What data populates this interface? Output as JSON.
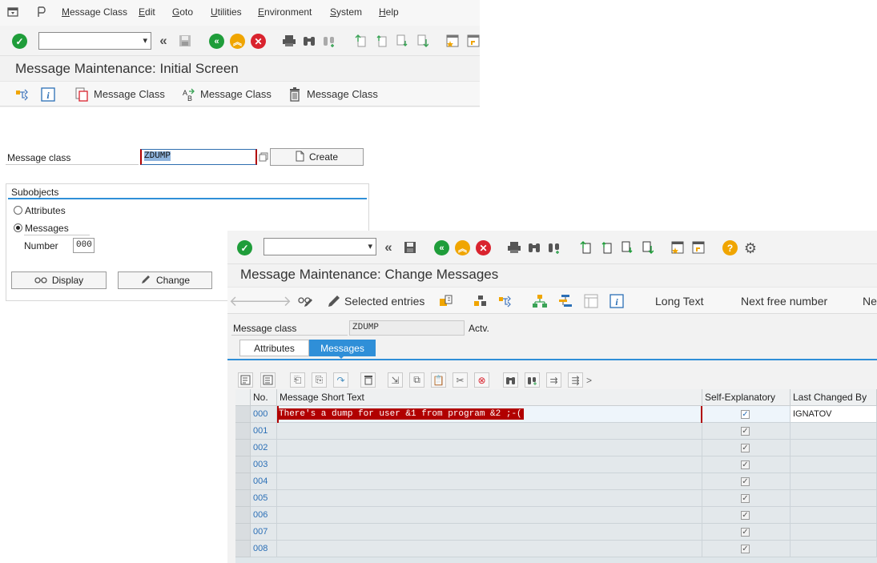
{
  "menu": {
    "items": [
      "Message Class",
      "Edit",
      "Goto",
      "Utilities",
      "Environment",
      "System",
      "Help"
    ],
    "underlines": [
      "M",
      "E",
      "G",
      "U",
      "E",
      "S",
      "H"
    ]
  },
  "initial_screen": {
    "title": "Message Maintenance: Initial Screen",
    "app_toolbar": {
      "btn1": "Message Class",
      "btn2": "Message Class",
      "btn3": "Message Class"
    },
    "message_class_label": "Message class",
    "message_class_value": "ZDUMP",
    "create_button": "Create",
    "subobjects": {
      "heading": "Subobjects",
      "attributes": "Attributes",
      "messages": "Messages",
      "number_label": "Number",
      "number_value": "000",
      "selected": "Messages"
    },
    "display_button": "Display",
    "change_button": "Change"
  },
  "change_screen": {
    "title": "Message Maintenance: Change Messages",
    "app_toolbar": {
      "selected_entries": "Selected entries",
      "long_text": "Long Text",
      "next_free_number": "Next free number",
      "next_cut": "Ne"
    },
    "message_class_label": "Message class",
    "message_class_value": "ZDUMP",
    "status": "Actv.",
    "tabs": [
      "Attributes",
      "Messages"
    ],
    "active_tab": "Messages",
    "table": {
      "columns": [
        "No.",
        "Message Short Text",
        "Self-Explanatory",
        "Last Changed By"
      ],
      "rows": [
        {
          "no": "000",
          "text": "There's a dump for user &1 from program &2 ;-(",
          "self_explanatory": true,
          "changed_by": "IGNATOV"
        },
        {
          "no": "001",
          "text": "",
          "self_explanatory": true,
          "changed_by": ""
        },
        {
          "no": "002",
          "text": "",
          "self_explanatory": true,
          "changed_by": ""
        },
        {
          "no": "003",
          "text": "",
          "self_explanatory": true,
          "changed_by": ""
        },
        {
          "no": "004",
          "text": "",
          "self_explanatory": true,
          "changed_by": ""
        },
        {
          "no": "005",
          "text": "",
          "self_explanatory": true,
          "changed_by": ""
        },
        {
          "no": "006",
          "text": "",
          "self_explanatory": true,
          "changed_by": ""
        },
        {
          "no": "007",
          "text": "",
          "self_explanatory": true,
          "changed_by": ""
        },
        {
          "no": "008",
          "text": "",
          "self_explanatory": true,
          "changed_by": ""
        }
      ]
    }
  },
  "colors": {
    "ok_green": "#1f9d3a",
    "warn_orange": "#f0a500",
    "cancel_red": "#d9232e",
    "accent_blue": "#2f8fd8",
    "selection_red": "#b10000"
  }
}
